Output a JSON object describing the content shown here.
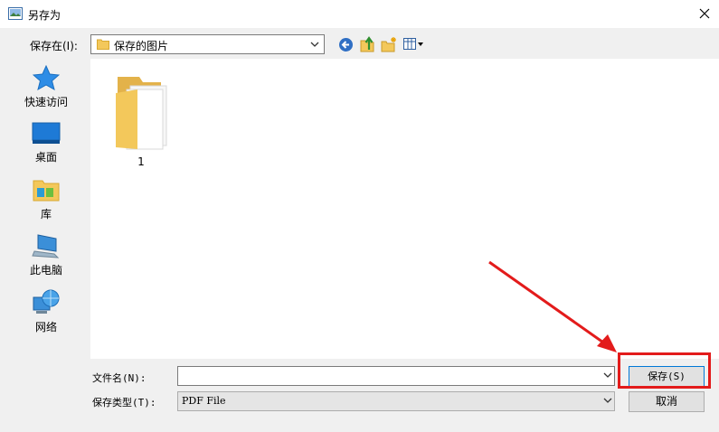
{
  "window": {
    "title": "另存为"
  },
  "toolbar": {
    "save_in_label": "保存在(I):",
    "location_value": "保存的图片",
    "icons": [
      "back-arrow-icon",
      "up-folder-icon",
      "new-folder-icon",
      "view-menu-icon"
    ]
  },
  "places": [
    {
      "label": "快速访问",
      "icon": "quick-access-star-icon"
    },
    {
      "label": "桌面",
      "icon": "desktop-icon"
    },
    {
      "label": "库",
      "icon": "library-icon"
    },
    {
      "label": "此电脑",
      "icon": "this-pc-icon"
    },
    {
      "label": "网络",
      "icon": "network-icon"
    }
  ],
  "files": [
    {
      "name": "1",
      "icon": "folder-icon"
    }
  ],
  "fields": {
    "filename_label": "文件名(N):",
    "filename_value": "",
    "filetype_label": "保存类型(T):",
    "filetype_value": "PDF File"
  },
  "buttons": {
    "save_label": "保存(S)",
    "cancel_label": "取消"
  },
  "colors": {
    "accent": "#0078d7",
    "annotation": "#e31b1b",
    "folder": "#f3c85b"
  }
}
